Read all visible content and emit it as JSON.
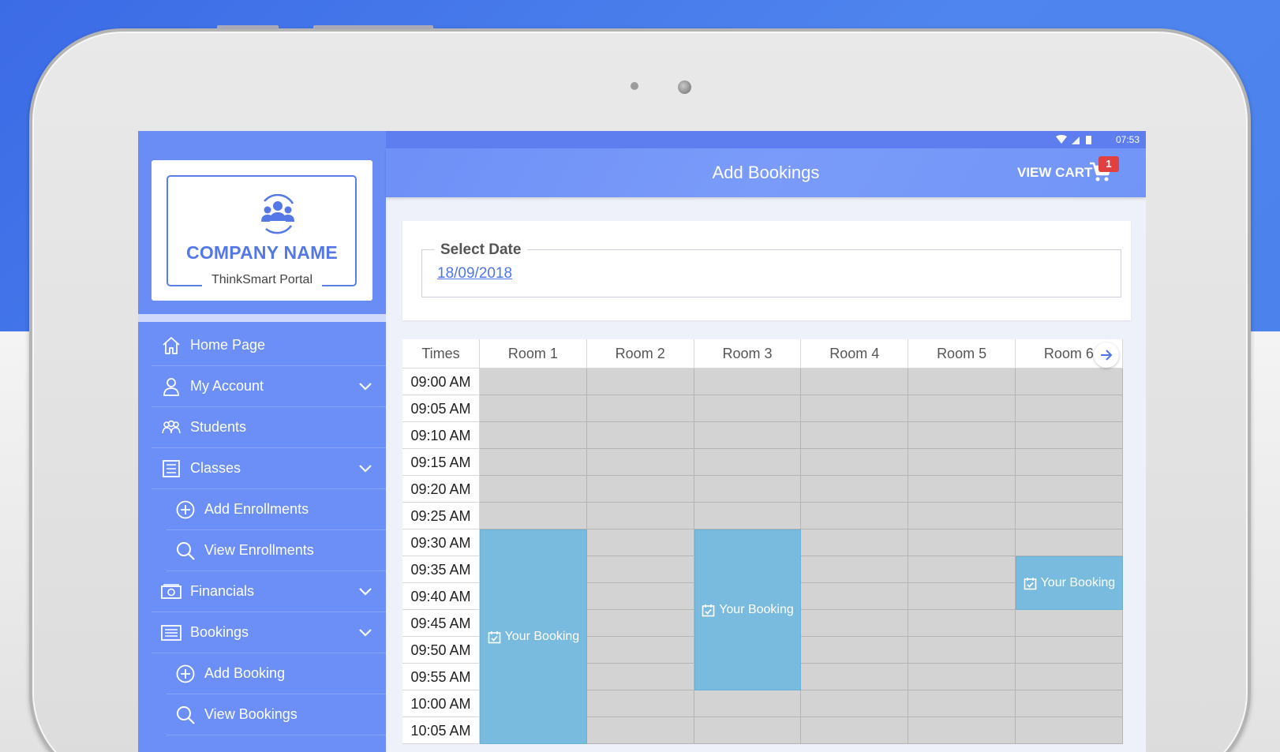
{
  "sidebar": {
    "company_name": "COMPANY NAME",
    "portal_name": "ThinkSmart Portal",
    "items": [
      {
        "label": "Home Page",
        "icon": "home-icon",
        "sub": false,
        "chevron": false
      },
      {
        "label": "My Account",
        "icon": "user-icon",
        "sub": false,
        "chevron": true
      },
      {
        "label": "Students",
        "icon": "students-icon",
        "sub": false,
        "chevron": false
      },
      {
        "label": "Classes",
        "icon": "list-icon",
        "sub": false,
        "chevron": true
      },
      {
        "label": "Add Enrollments",
        "icon": "plus-circle-icon",
        "sub": true,
        "chevron": false
      },
      {
        "label": "View Enrollments",
        "icon": "search-icon",
        "sub": true,
        "chevron": false
      },
      {
        "label": "Financials",
        "icon": "money-icon",
        "sub": false,
        "chevron": true
      },
      {
        "label": "Bookings",
        "icon": "bookings-icon",
        "sub": false,
        "chevron": true
      },
      {
        "label": "Add Booking",
        "icon": "plus-circle-icon",
        "sub": true,
        "chevron": false
      },
      {
        "label": "View Bookings",
        "icon": "search-icon",
        "sub": true,
        "chevron": false
      }
    ]
  },
  "status_bar": {
    "time": "07:53"
  },
  "header": {
    "title": "Add Bookings",
    "cart_label": "VIEW CART",
    "cart_count": "1"
  },
  "date_picker": {
    "legend": "Select Date",
    "value": "18/09/2018"
  },
  "schedule": {
    "times_header": "Times",
    "rooms": [
      "Room 1",
      "Room 2",
      "Room 3",
      "Room 4",
      "Room 5",
      "Room 6"
    ],
    "times": [
      "09:00 AM",
      "09:05 AM",
      "09:10 AM",
      "09:15 AM",
      "09:20 AM",
      "09:25 AM",
      "09:30 AM",
      "09:35 AM",
      "09:40 AM",
      "09:45 AM",
      "09:50 AM",
      "09:55 AM",
      "10:00 AM",
      "10:05 AM"
    ],
    "bookings": [
      {
        "room": 0,
        "start": "09:30 AM",
        "end": "10:10 AM",
        "label": "Your Booking"
      },
      {
        "room": 2,
        "start": "09:30 AM",
        "end": "10:00 AM",
        "label": "Your Booking"
      },
      {
        "room": 5,
        "start": "09:35 AM",
        "end": "09:45 AM",
        "label": "Your Booking"
      }
    ]
  },
  "colors": {
    "sidebar": "#6b8ff7",
    "header": "#7195f7",
    "booking": "#79bbdf",
    "slot": "#d3d3d3",
    "badge": "#e04040"
  }
}
